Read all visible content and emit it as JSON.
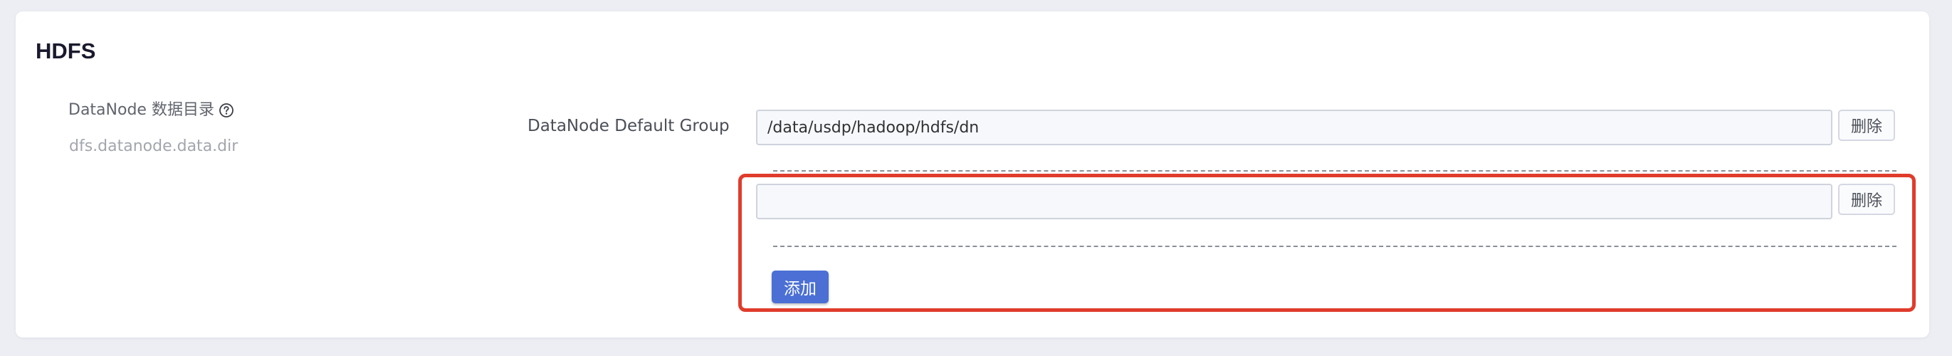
{
  "section": {
    "title": "HDFS"
  },
  "property": {
    "label": "DataNode 数据目录",
    "key": "dfs.datanode.data.dir",
    "help_icon": "question-circle-icon"
  },
  "group": {
    "label": "DataNode Default Group"
  },
  "dir_entries": [
    {
      "value": "/data/usdp/hadoop/hdfs/dn",
      "placeholder": "",
      "delete_label": "删除"
    },
    {
      "value": "",
      "placeholder": "",
      "delete_label": "删除"
    }
  ],
  "actions": {
    "add_label": "添加"
  },
  "colors": {
    "accent": "#4b6fd5",
    "highlight": "#e03c2c",
    "background": "#eceef4"
  }
}
